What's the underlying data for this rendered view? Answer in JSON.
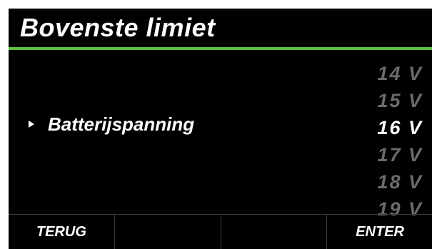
{
  "header": {
    "title": "Bovenste limiet"
  },
  "colors": {
    "accent": "#5fbf3f",
    "selected_value": "#ffffff",
    "dimmed_value": "#6b6b6b"
  },
  "setting": {
    "label": "Batterijspanning",
    "pointer_icon": "triangle-right"
  },
  "values": [
    {
      "label": "14 V",
      "selected": false
    },
    {
      "label": "15 V",
      "selected": false
    },
    {
      "label": "16 V",
      "selected": true
    },
    {
      "label": "17 V",
      "selected": false
    },
    {
      "label": "18 V",
      "selected": false
    },
    {
      "label": "19 V",
      "selected": false
    }
  ],
  "softkeys": [
    "TERUG",
    "",
    "",
    "ENTER"
  ]
}
